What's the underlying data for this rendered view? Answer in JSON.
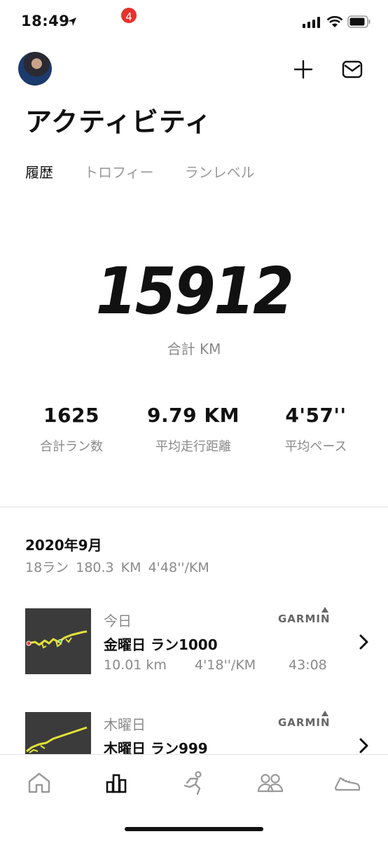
{
  "status_bar": {
    "time": "18:49"
  },
  "header": {
    "title": "アクティビティ"
  },
  "tabs": [
    {
      "label": "履歴",
      "active": true
    },
    {
      "label": "トロフィー",
      "active": false
    },
    {
      "label": "ランレベル",
      "active": false
    }
  ],
  "totals": {
    "distance_value": "15912",
    "distance_unit": "合計 KM",
    "stats": [
      {
        "value": "1625",
        "label": "合計ラン数"
      },
      {
        "value": "9.79 KM",
        "label": "平均走行距離"
      },
      {
        "value": "4'57''",
        "label": "平均ペース"
      }
    ]
  },
  "month": {
    "title": "2020年9月",
    "runs": "18ラン",
    "distance": "180.3 KM",
    "pace": "4'48''/KM"
  },
  "activities": [
    {
      "day": "今日",
      "source": "GARMIN",
      "name": "金曜日 ラン1000",
      "distance": "10.01 km",
      "pace": "4'18''/KM",
      "duration": "43:08"
    },
    {
      "day": "木曜日",
      "source": "GARMIN",
      "name": "木曜日 ラン999"
    }
  ],
  "nav": {
    "items": [
      "home-icon",
      "activity-icon",
      "run-icon",
      "club-icon",
      "shoe-icon"
    ],
    "badge_count": "4"
  },
  "colors": {
    "accent_route": "#e2e23a",
    "badge": "#e8322b",
    "thumb_bg": "#3b3b3b"
  }
}
